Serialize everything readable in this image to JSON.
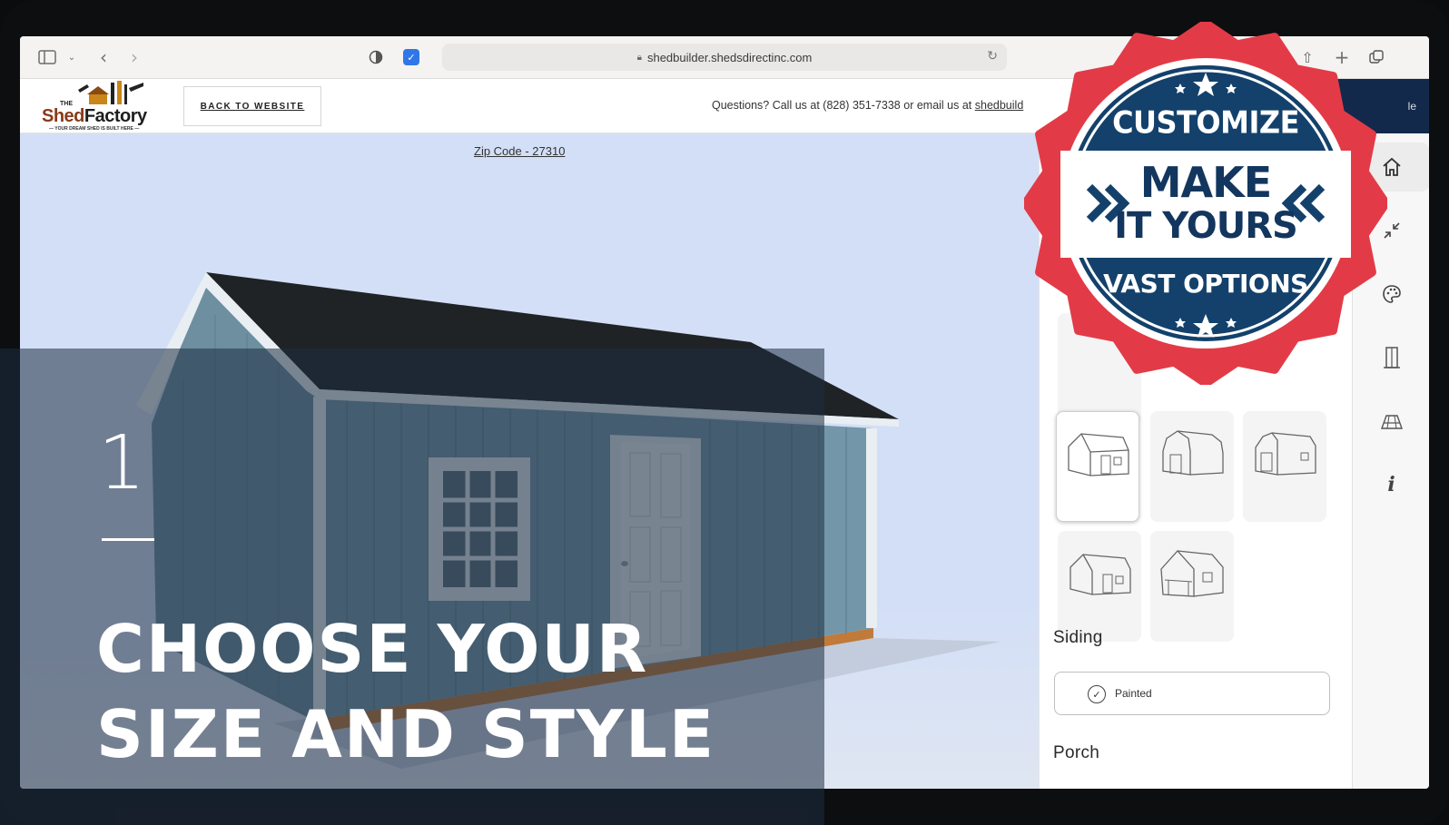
{
  "browser": {
    "url": "shedbuilder.shedsdirectinc.com"
  },
  "header": {
    "logo_the": "THE",
    "logo_shed": "Shed",
    "logo_factory": "Factory",
    "logo_tagline": "— YOUR DREAM SHED IS BUILT HERE —",
    "back_label": "BACK TO WEBSITE",
    "questions_prefix": "Questions? Call us at (828) 351-7338 or email us at ",
    "questions_email": "shedbuild",
    "dark_button_label": "le"
  },
  "canvas": {
    "zip_code": "Zip Code - 27310"
  },
  "panel": {
    "siding_label": "Siding",
    "siding_value": "Painted",
    "porch_label": "Porch"
  },
  "overlay": {
    "step_number": "1",
    "headline_line1": "CHOOSE YOUR",
    "headline_line2": "SIZE AND STYLE"
  },
  "badge": {
    "top": "CUSTOMIZE",
    "middle1": "MAKE",
    "middle2": "IT YOURS",
    "bottom": "VAST OPTIONS"
  },
  "colors": {
    "badge_red": "#e23b47",
    "badge_navy": "#13416b",
    "header_navy": "#13294b",
    "shed_siding": "#7296a6",
    "shed_roof": "#1f2326"
  },
  "icons": [
    "sidebar-icon",
    "chevron-left-icon",
    "chevron-right-icon",
    "shield-icon",
    "lock-icon",
    "reload-icon",
    "share-icon",
    "plus-icon",
    "tabs-icon",
    "home-icon",
    "resize-icon",
    "palette-icon",
    "door-icon",
    "shelves-icon",
    "info-icon"
  ]
}
